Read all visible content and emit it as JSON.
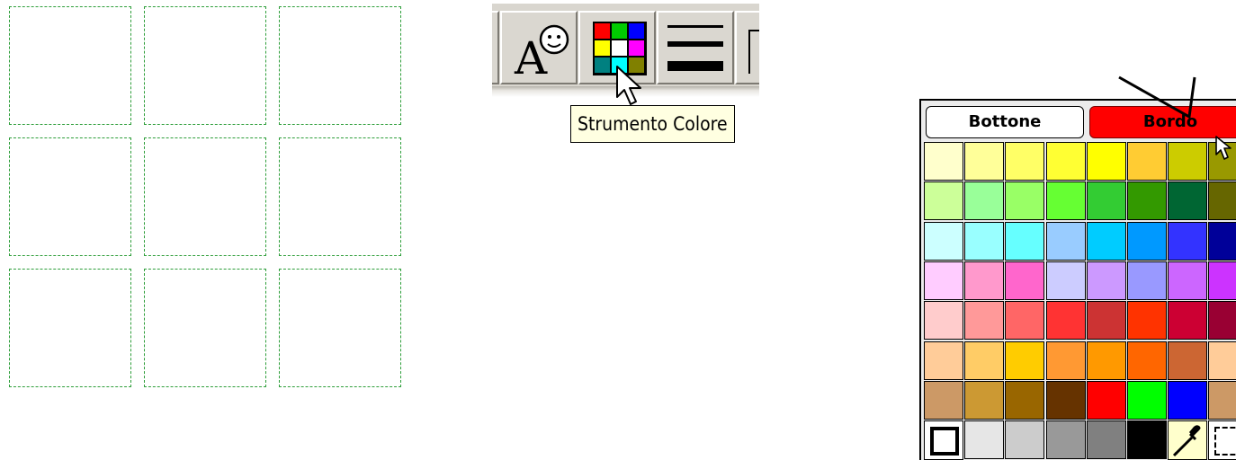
{
  "toolbar": {
    "buttons": [
      {
        "name": "text-emoji-tool-button",
        "icon": "text-smiley-icon"
      },
      {
        "name": "color-tool-button",
        "icon": "color-grid-icon"
      },
      {
        "name": "line-tool-button",
        "icon": "line-thickness-icon"
      }
    ],
    "color_icon_colors": [
      "#ff0000",
      "#00cc00",
      "#0000ff",
      "#ffff00",
      "#ffffff",
      "#ff00ff",
      "#008080",
      "#00ffff",
      "#808000"
    ]
  },
  "tooltip": {
    "text": "Strumento Colore"
  },
  "palette": {
    "tabs": {
      "bottone": "Bottone",
      "bordo": "Bordo"
    },
    "swatch_rows": [
      [
        "#ffffcc",
        "#ffff99",
        "#ffff66",
        "#ffff33",
        "#ffff00",
        "#ffcc33",
        "#cccc00",
        "#999900"
      ],
      [
        "#ccff99",
        "#99ff99",
        "#99ff66",
        "#66ff33",
        "#33cc33",
        "#339900",
        "#006633",
        "#666600"
      ],
      [
        "#ccffff",
        "#99ffff",
        "#66ffff",
        "#99ccff",
        "#00ccff",
        "#0099ff",
        "#3333ff",
        "#000099"
      ],
      [
        "#ffccff",
        "#ff99cc",
        "#ff66cc",
        "#ccccff",
        "#cc99ff",
        "#9999ff",
        "#cc66ff",
        "#cc33ff"
      ],
      [
        "#ffcccc",
        "#ff9999",
        "#ff6666",
        "#ff3333",
        "#cc3333",
        "#ff3300",
        "#cc0033",
        "#990033"
      ],
      [
        "#ffcc99",
        "#ffcc66",
        "#ffcc00",
        "#ff9933",
        "#ff9900",
        "#ff6600",
        "#cc6633",
        "#ffcc99"
      ],
      [
        "#cc9966",
        "#cc9933",
        "#996600",
        "#663300",
        "#ff0000",
        "#00ff00",
        "#0000ff",
        "#cc9966"
      ]
    ],
    "bottom_row": [
      "#e6e6e6",
      "#cccccc",
      "#999999",
      "#808080",
      "#000000"
    ],
    "tools": {
      "border_icon": "square-border-icon",
      "eyedropper_icon": "eyedropper-icon",
      "transparent_icon": "transparent-icon"
    }
  },
  "grid": {
    "rows": 3,
    "columns": 3,
    "border_color": "#2e9e3a"
  }
}
